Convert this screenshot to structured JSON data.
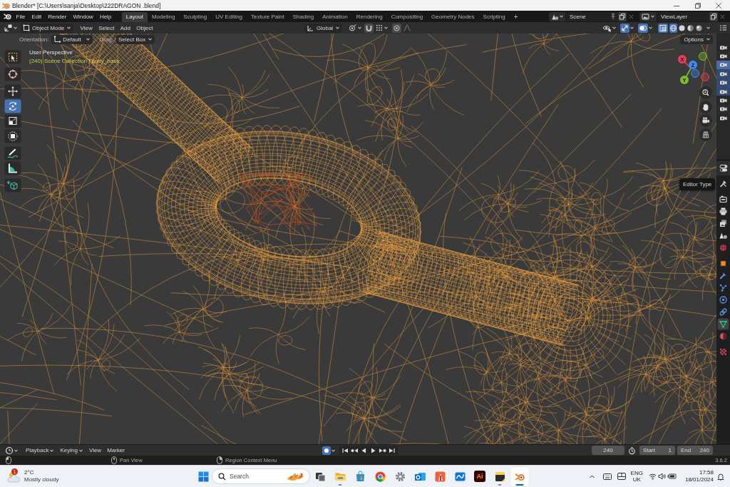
{
  "window": {
    "title": "Blender* [C:\\Users\\sanja\\Desktop\\222DRAGON .blend]"
  },
  "topbar": {
    "menus": [
      "File",
      "Edit",
      "Render",
      "Window",
      "Help"
    ],
    "workspaces": [
      {
        "label": "Layout",
        "selected": true
      },
      {
        "label": "Modeling",
        "selected": false
      },
      {
        "label": "Sculpting",
        "selected": false
      },
      {
        "label": "UV Editing",
        "selected": false
      },
      {
        "label": "Texture Paint",
        "selected": false
      },
      {
        "label": "Shading",
        "selected": false
      },
      {
        "label": "Animation",
        "selected": false
      },
      {
        "label": "Rendering",
        "selected": false
      },
      {
        "label": "Compositing",
        "selected": false
      },
      {
        "label": "Geometry Nodes",
        "selected": false
      },
      {
        "label": "Scripting",
        "selected": false
      }
    ],
    "add_workspace": "+",
    "scene": "Scene",
    "view_layer": "ViewLayer"
  },
  "viewport_header": {
    "mode": "Object Mode",
    "menus": [
      "View",
      "Select",
      "Add",
      "Object"
    ],
    "orientation": "Global",
    "snap": false,
    "proportional_editing": false,
    "show_gizmos": true,
    "show_overlays": true,
    "xray": true,
    "shading": [
      {
        "kind": "wireframe",
        "selected": true
      },
      {
        "kind": "solid",
        "selected": false
      },
      {
        "kind": "material",
        "selected": false
      },
      {
        "kind": "rendered",
        "selected": false
      }
    ]
  },
  "tool_settings": {
    "orientation_label": "Orientation:",
    "orientation": "Default",
    "drag_label": "Drag:",
    "drag": "Select Box",
    "options": "Options"
  },
  "viewport": {
    "view_name": "User Perspective",
    "info": "(240) Scene Collection | body_base",
    "toolbar": [
      {
        "tools": [
          {
            "kind": "select_box",
            "selected": false
          }
        ]
      },
      {
        "tools": [
          {
            "kind": "cursor",
            "selected": false
          }
        ]
      },
      {
        "tools": [
          {
            "kind": "move",
            "selected": false
          },
          {
            "kind": "rotate",
            "selected": true
          },
          {
            "kind": "scale",
            "selected": false
          },
          {
            "kind": "transform",
            "selected": false
          }
        ]
      },
      {
        "tools": [
          {
            "kind": "annotate",
            "selected": false
          },
          {
            "kind": "measure",
            "selected": false
          }
        ]
      },
      {
        "tools": [
          {
            "kind": "add_cube",
            "selected": false
          }
        ]
      }
    ],
    "gizmo": [
      {
        "label": "X",
        "color": "#e5405a"
      },
      {
        "label": "Y",
        "color": "#7bbf2a"
      },
      {
        "label": "Z",
        "color": "#3d8cf0"
      }
    ]
  },
  "tooltip": "Editor Type",
  "outliner": {
    "rows": [
      {
        "selected": false,
        "active": false
      },
      {
        "selected": false,
        "active": false
      },
      {
        "selected": true,
        "active": true
      },
      {
        "selected": true,
        "active": false
      },
      {
        "selected": true,
        "active": false
      },
      {
        "selected": true,
        "active": false
      },
      {
        "selected": false,
        "active": false
      },
      {
        "selected": false,
        "active": false
      },
      {
        "selected": false,
        "active": false
      }
    ]
  },
  "properties": {
    "tab_groups": [
      {
        "tabs": [
          {
            "kind": "tool",
            "selected": false
          }
        ]
      },
      {
        "tabs": [
          {
            "kind": "render",
            "selected": false
          },
          {
            "kind": "output",
            "selected": false
          },
          {
            "kind": "view_layer",
            "selected": false
          },
          {
            "kind": "scene",
            "selected": false
          },
          {
            "kind": "world",
            "selected": false
          }
        ]
      },
      {
        "tabs": [
          {
            "kind": "object",
            "selected": false
          },
          {
            "kind": "modifiers",
            "selected": false
          },
          {
            "kind": "particles",
            "selected": false
          },
          {
            "kind": "physics",
            "selected": false
          },
          {
            "kind": "constraints",
            "selected": false
          },
          {
            "kind": "data",
            "selected": true
          },
          {
            "kind": "material",
            "selected": false
          }
        ]
      },
      {
        "tabs": [
          {
            "kind": "texture",
            "selected": false
          }
        ]
      }
    ]
  },
  "timeline": {
    "menus": [
      {
        "label": "Playback",
        "kind": "dropdown"
      },
      {
        "label": "Keying",
        "kind": "dropdown"
      },
      {
        "label": "View",
        "kind": "menu"
      },
      {
        "label": "Marker",
        "kind": "menu"
      }
    ],
    "auto_keying": true,
    "current_frame": "240",
    "preview_range": false,
    "start_label": "Start",
    "start": "1",
    "end_label": "End",
    "end": "240"
  },
  "status_bar": {
    "hints": [
      {
        "kind": "mouse_left"
      },
      {
        "kind": "mouse_middle",
        "label": "Pan View"
      },
      {
        "kind": "mouse_right",
        "label": "Region Context Menu"
      }
    ],
    "version": "3.6.2"
  },
  "taskbar": {
    "weather": {
      "badge": "1",
      "temperature": "2°C",
      "condition": "Mostly cloudy"
    },
    "search_placeholder": "Search",
    "apps": [
      {
        "kind": "task_view",
        "running": false,
        "active": false
      },
      {
        "kind": "file_explorer",
        "running": true,
        "active": false
      },
      {
        "kind": "store",
        "running": false,
        "active": false
      },
      {
        "kind": "browser",
        "running": false,
        "active": false
      },
      {
        "kind": "settings",
        "running": false,
        "active": false
      },
      {
        "kind": "mail",
        "running": false,
        "active": false
      },
      {
        "kind": "paint",
        "running": false,
        "active": false
      },
      {
        "kind": "whiteboard",
        "running": false,
        "active": false
      },
      {
        "kind": "illustrator",
        "label": "Ai",
        "running": false,
        "active": false
      },
      {
        "kind": "notes",
        "running": true,
        "active": false
      },
      {
        "kind": "blender",
        "running": true,
        "active": true
      }
    ],
    "language": "ENG",
    "region": "UK",
    "time": "17:58",
    "date": "18/01/2024"
  }
}
